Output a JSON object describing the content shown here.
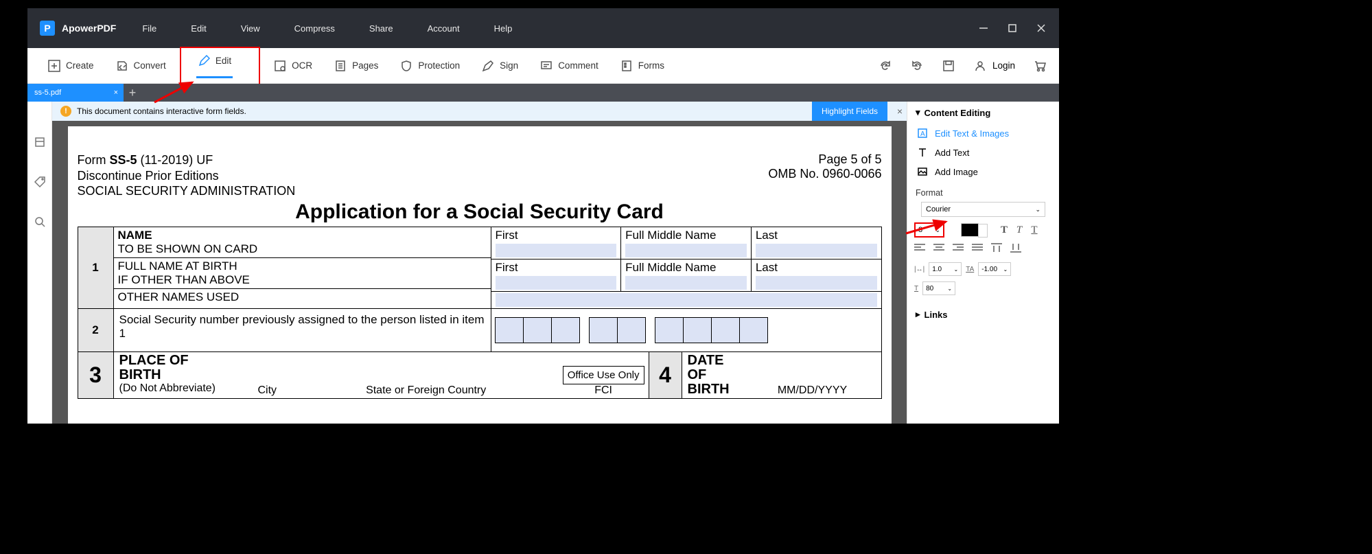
{
  "app": {
    "name": "ApowerPDF"
  },
  "menu": [
    "File",
    "Edit",
    "View",
    "Compress",
    "Share",
    "Account",
    "Help"
  ],
  "toolbar": {
    "create": "Create",
    "convert": "Convert",
    "edit": "Edit",
    "ocr": "OCR",
    "pages": "Pages",
    "protection": "Protection",
    "sign": "Sign",
    "comment": "Comment",
    "forms": "Forms",
    "login": "Login"
  },
  "tab": {
    "name": "ss-5.pdf"
  },
  "notif": {
    "text": "This document contains interactive form fields.",
    "highlight": "Highlight Fields"
  },
  "doc": {
    "form_line1a": "Form ",
    "form_line1b": "SS-5",
    "form_line1c": " (11-2019) UF",
    "form_line2": "Discontinue Prior Editions",
    "form_line3": "SOCIAL SECURITY ADMINISTRATION",
    "page_info": "Page 5 of 5",
    "omb": "OMB No. 0960-0066",
    "title": "Application for a Social Security Card",
    "name_hdr": "NAME",
    "name_sub": "TO BE SHOWN ON CARD",
    "fullname": "FULL NAME AT BIRTH",
    "ifother": "IF OTHER THAN ABOVE",
    "othernames": "OTHER NAMES USED",
    "first": "First",
    "middle": "Full Middle Name",
    "last": "Last",
    "sec2": "Social Security number previously assigned to the person listed in item 1",
    "placeof": "PLACE OF",
    "birth": "BIRTH",
    "noabbrev": "(Do Not Abbreviate)",
    "city": "City",
    "state": "State or Foreign Country",
    "fci": "FCI",
    "officeuse": "Office Use Only",
    "dateof": "DATE OF",
    "birth2": "BIRTH",
    "mmdd": "MM/DD/YYYY"
  },
  "panel": {
    "content_editing": "Content Editing",
    "edit_text": "Edit Text & Images",
    "add_text": "Add Text",
    "add_image": "Add Image",
    "format": "Format",
    "font": "Courier",
    "size": "8",
    "spacing1": "1.0",
    "spacing2": "-1.00",
    "spacing3": "80",
    "links": "Links"
  }
}
